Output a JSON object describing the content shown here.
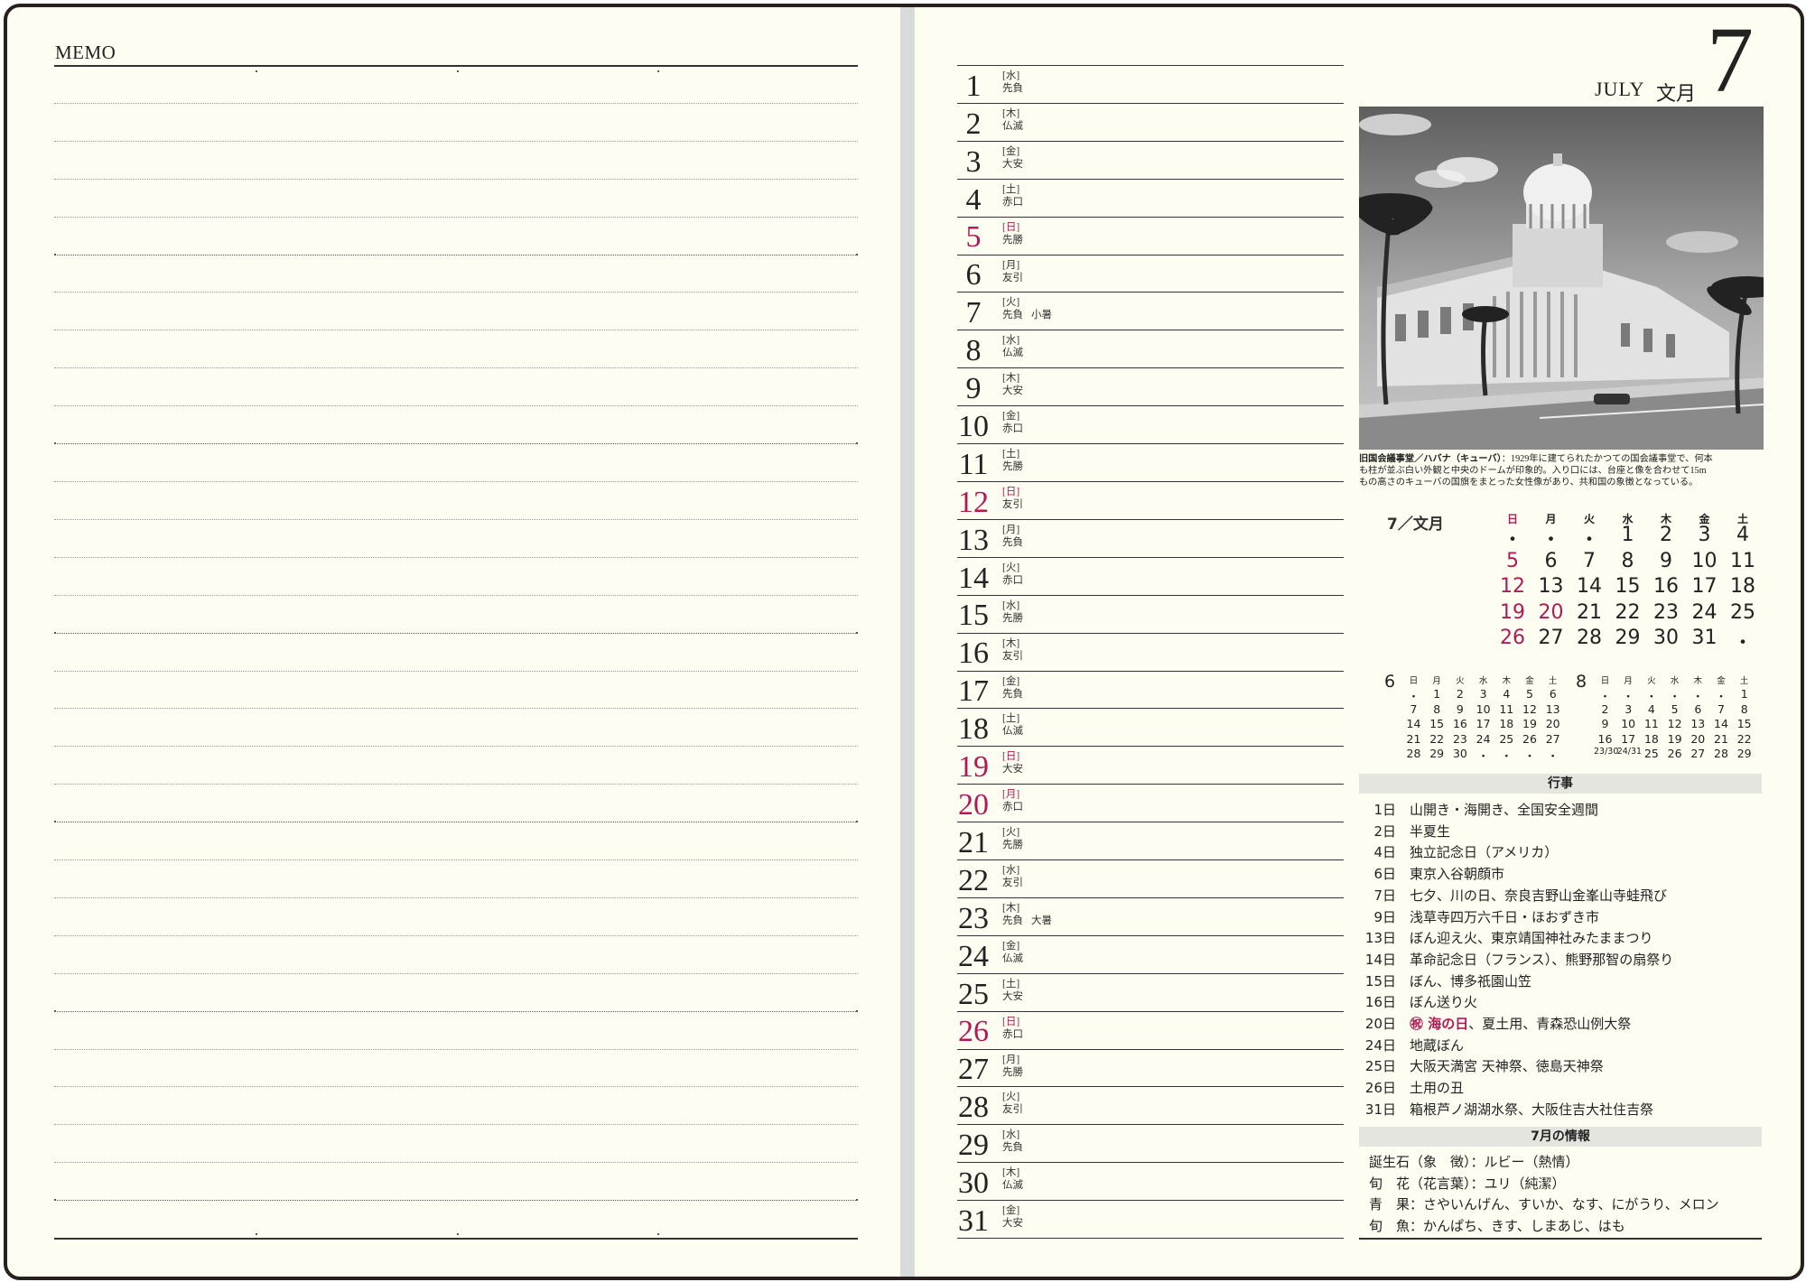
{
  "memo": {
    "title": "MEMO"
  },
  "month": {
    "en": "JULY",
    "jp": "文月",
    "num": "7"
  },
  "days": [
    {
      "d": "1",
      "dow": "[水]",
      "rok": "先負",
      "red": false,
      "note": ""
    },
    {
      "d": "2",
      "dow": "[木]",
      "rok": "仏滅",
      "red": false,
      "note": ""
    },
    {
      "d": "3",
      "dow": "[金]",
      "rok": "大安",
      "red": false,
      "note": ""
    },
    {
      "d": "4",
      "dow": "[土]",
      "rok": "赤口",
      "red": false,
      "note": ""
    },
    {
      "d": "5",
      "dow": "[日]",
      "rok": "先勝",
      "red": true,
      "note": ""
    },
    {
      "d": "6",
      "dow": "[月]",
      "rok": "友引",
      "red": false,
      "note": ""
    },
    {
      "d": "7",
      "dow": "[火]",
      "rok": "先負",
      "red": false,
      "note": "小暑"
    },
    {
      "d": "8",
      "dow": "[水]",
      "rok": "仏滅",
      "red": false,
      "note": ""
    },
    {
      "d": "9",
      "dow": "[木]",
      "rok": "大安",
      "red": false,
      "note": ""
    },
    {
      "d": "10",
      "dow": "[金]",
      "rok": "赤口",
      "red": false,
      "note": ""
    },
    {
      "d": "11",
      "dow": "[土]",
      "rok": "先勝",
      "red": false,
      "note": ""
    },
    {
      "d": "12",
      "dow": "[日]",
      "rok": "友引",
      "red": true,
      "note": ""
    },
    {
      "d": "13",
      "dow": "[月]",
      "rok": "先負",
      "red": false,
      "note": ""
    },
    {
      "d": "14",
      "dow": "[火]",
      "rok": "赤口",
      "red": false,
      "note": ""
    },
    {
      "d": "15",
      "dow": "[水]",
      "rok": "先勝",
      "red": false,
      "note": ""
    },
    {
      "d": "16",
      "dow": "[木]",
      "rok": "友引",
      "red": false,
      "note": ""
    },
    {
      "d": "17",
      "dow": "[金]",
      "rok": "先負",
      "red": false,
      "note": ""
    },
    {
      "d": "18",
      "dow": "[土]",
      "rok": "仏滅",
      "red": false,
      "note": ""
    },
    {
      "d": "19",
      "dow": "[日]",
      "rok": "大安",
      "red": true,
      "note": ""
    },
    {
      "d": "20",
      "dow": "[月]",
      "rok": "赤口",
      "red": true,
      "note": ""
    },
    {
      "d": "21",
      "dow": "[火]",
      "rok": "先勝",
      "red": false,
      "note": ""
    },
    {
      "d": "22",
      "dow": "[水]",
      "rok": "友引",
      "red": false,
      "note": ""
    },
    {
      "d": "23",
      "dow": "[木]",
      "rok": "先負",
      "red": false,
      "note": "大暑"
    },
    {
      "d": "24",
      "dow": "[金]",
      "rok": "仏滅",
      "red": false,
      "note": ""
    },
    {
      "d": "25",
      "dow": "[土]",
      "rok": "大安",
      "red": false,
      "note": ""
    },
    {
      "d": "26",
      "dow": "[日]",
      "rok": "赤口",
      "red": true,
      "note": ""
    },
    {
      "d": "27",
      "dow": "[月]",
      "rok": "先勝",
      "red": false,
      "note": ""
    },
    {
      "d": "28",
      "dow": "[火]",
      "rok": "友引",
      "red": false,
      "note": ""
    },
    {
      "d": "29",
      "dow": "[水]",
      "rok": "先負",
      "red": false,
      "note": ""
    },
    {
      "d": "30",
      "dow": "[木]",
      "rok": "仏滅",
      "red": false,
      "note": ""
    },
    {
      "d": "31",
      "dow": "[金]",
      "rok": "大安",
      "red": false,
      "note": ""
    }
  ],
  "photo": {
    "caption_title": "旧国会議事堂／ハバナ（キューバ）",
    "caption_lines": [
      "：1929年に建てられたかつての国会議事堂で、何本",
      "も柱が並ぶ白い外観と中央のドームが印象的。入り口には、台座と像を合わせて15m",
      "もの高さのキューバの国旗をまとった女性像があり、共和国の象徴となっている。"
    ]
  },
  "main_calendar": {
    "title": "7／文月",
    "weekdays": [
      "日",
      "月",
      "火",
      "水",
      "木",
      "金",
      "土"
    ],
    "weeks": [
      [
        "・",
        "・",
        "・",
        "1",
        "2",
        "3",
        "4"
      ],
      [
        "5",
        "6",
        "7",
        "8",
        "9",
        "10",
        "11"
      ],
      [
        "12",
        "13",
        "14",
        "15",
        "16",
        "17",
        "18"
      ],
      [
        "19",
        "20",
        "21",
        "22",
        "23",
        "24",
        "25"
      ],
      [
        "26",
        "27",
        "28",
        "29",
        "30",
        "31",
        "・"
      ]
    ],
    "red_days": [
      "5",
      "12",
      "19",
      "20",
      "26"
    ]
  },
  "mini_june": {
    "month": "6",
    "weekdays": [
      "日",
      "月",
      "火",
      "水",
      "木",
      "金",
      "土"
    ],
    "weeks": [
      [
        "・",
        "1",
        "2",
        "3",
        "4",
        "5",
        "6"
      ],
      [
        "7",
        "8",
        "9",
        "10",
        "11",
        "12",
        "13"
      ],
      [
        "14",
        "15",
        "16",
        "17",
        "18",
        "19",
        "20"
      ],
      [
        "21",
        "22",
        "23",
        "24",
        "25",
        "26",
        "27"
      ],
      [
        "28",
        "29",
        "30",
        "・",
        "・",
        "・",
        "・"
      ]
    ],
    "red_days": [
      "7",
      "14",
      "21",
      "28"
    ]
  },
  "mini_august": {
    "month": "8",
    "weekdays": [
      "日",
      "月",
      "火",
      "水",
      "木",
      "金",
      "土"
    ],
    "weeks": [
      [
        "・",
        "・",
        "・",
        "・",
        "・",
        "・",
        "1"
      ],
      [
        "2",
        "3",
        "4",
        "5",
        "6",
        "7",
        "8"
      ],
      [
        "9",
        "10",
        "11",
        "12",
        "13",
        "14",
        "15"
      ],
      [
        "16",
        "17",
        "18",
        "19",
        "20",
        "21",
        "22"
      ],
      [
        "23/30",
        "24/31",
        "25",
        "26",
        "27",
        "28",
        "29"
      ]
    ],
    "red_days": [
      "2",
      "9",
      "11",
      "16",
      "23/30"
    ]
  },
  "events_title": "行事",
  "events": [
    {
      "day": "1日",
      "text": "山開き・海開き、全国安全週間",
      "red": false,
      "holiday": ""
    },
    {
      "day": "2日",
      "text": "半夏生",
      "red": false,
      "holiday": ""
    },
    {
      "day": "4日",
      "text": "独立記念日（アメリカ）",
      "red": false,
      "holiday": ""
    },
    {
      "day": "6日",
      "text": "東京入谷朝顔市",
      "red": false,
      "holiday": ""
    },
    {
      "day": "7日",
      "text": "七夕、川の日、奈良吉野山金峯山寺蛙飛び",
      "red": false,
      "holiday": ""
    },
    {
      "day": "9日",
      "text": "浅草寺四万六千日・ほおずき市",
      "red": false,
      "holiday": ""
    },
    {
      "day": "13日",
      "text": "ぼん迎え火、東京靖国神社みたままつり",
      "red": false,
      "holiday": ""
    },
    {
      "day": "14日",
      "text": "革命記念日（フランス）、熊野那智の扇祭り",
      "red": false,
      "holiday": ""
    },
    {
      "day": "15日",
      "text": "ぼん、博多祇園山笠",
      "red": false,
      "holiday": ""
    },
    {
      "day": "16日",
      "text": "ぼん送り火",
      "red": false,
      "holiday": ""
    },
    {
      "day": "20日",
      "text": "、夏土用、青森恐山例大祭",
      "red": true,
      "holiday": "㊗ 海の日"
    },
    {
      "day": "24日",
      "text": "地蔵ぼん",
      "red": false,
      "holiday": ""
    },
    {
      "day": "25日",
      "text": "大阪天満宮 天神祭、徳島天神祭",
      "red": false,
      "holiday": ""
    },
    {
      "day": "26日",
      "text": "土用の丑",
      "red": true,
      "holiday": ""
    },
    {
      "day": "31日",
      "text": "箱根芦ノ湖湖水祭、大阪住吉大社住吉祭",
      "red": false,
      "holiday": ""
    }
  ],
  "info_title": "7月の情報",
  "info": [
    "誕生石（象　徴）：ルビー（熱情）",
    "旬　花（花言葉）：ユリ（純潔）",
    "青　果：さやいんげん、すいか、なす、にがうり、メロン",
    "旬　魚：かんぱち、きす、しまあじ、はも"
  ],
  "colors": {
    "accent_red": "#b01b55",
    "paper": "#fdfdf1",
    "band": "#e5e5e0"
  }
}
